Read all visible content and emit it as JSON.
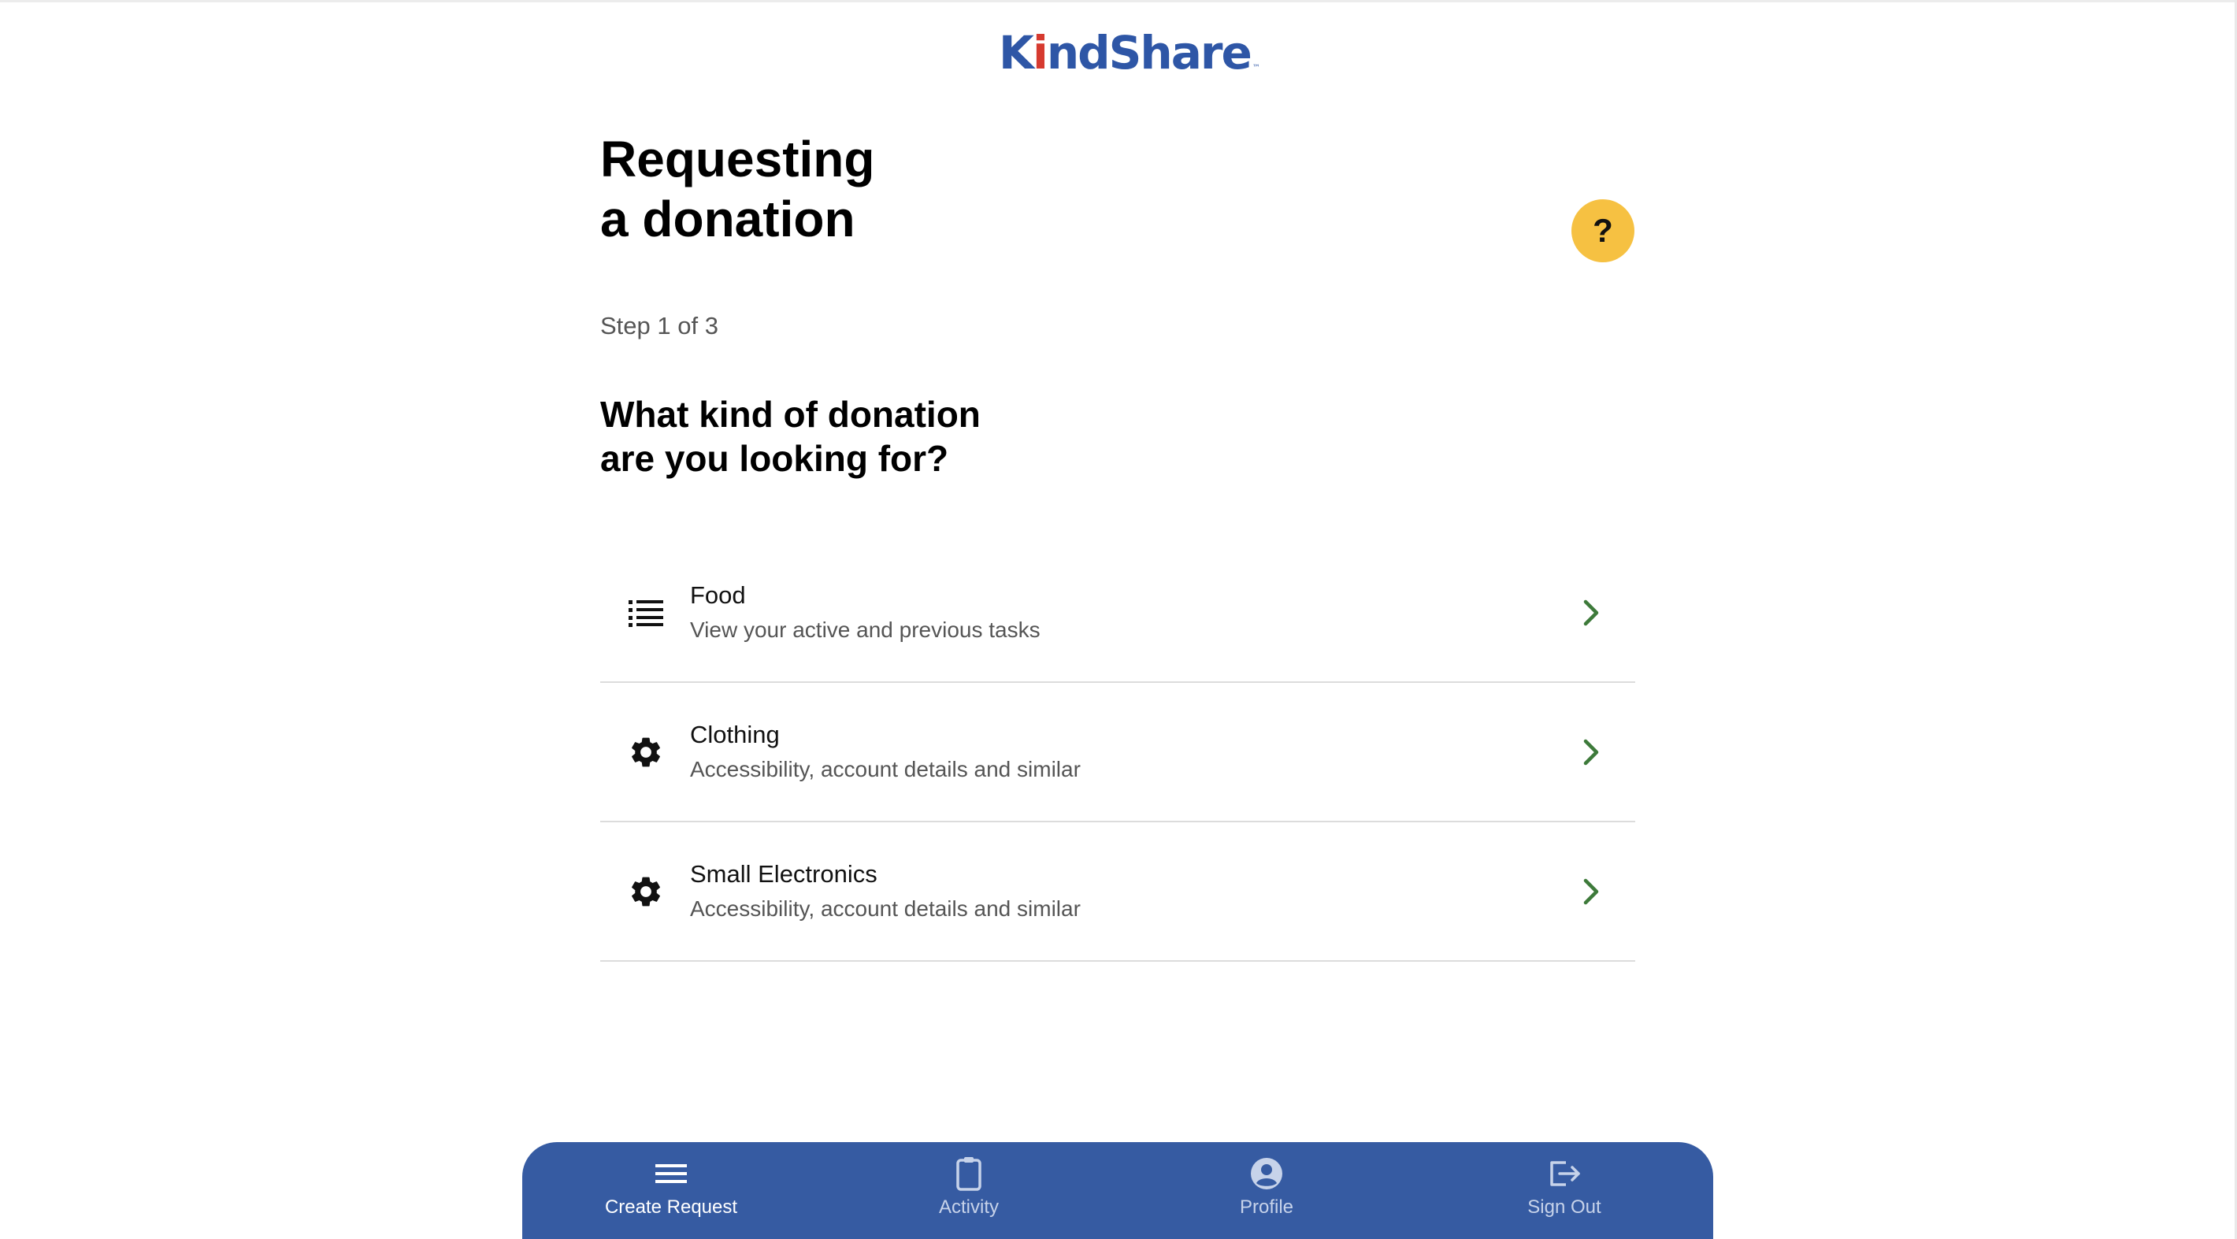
{
  "brand": {
    "logo_text_left": "K",
    "logo_text_i": "i",
    "logo_text_rest": "ndShare",
    "logo_tm": "™",
    "colors": {
      "primary": "#2e56a6",
      "accent_red": "#d63a2f",
      "help_yellow": "#f6c142",
      "chevron_green": "#3d7a3a",
      "nav_bg": "#365ba2"
    }
  },
  "header": {
    "title_line1": "Requesting",
    "title_line2": "a donation",
    "help_label": "?"
  },
  "wizard": {
    "step_label": "Step 1 of 3",
    "question_line1": "What kind of donation",
    "question_line2": "are you looking for?"
  },
  "options": [
    {
      "title": "Food",
      "subtitle": "View your active and previous tasks",
      "icon": "list-icon"
    },
    {
      "title": "Clothing",
      "subtitle": "Accessibility, account details and similar",
      "icon": "gear-icon"
    },
    {
      "title": "Small Electronics",
      "subtitle": "Accessibility, account details and similar",
      "icon": "gear-icon"
    }
  ],
  "nav": {
    "items": [
      {
        "label": "Create Request",
        "icon": "menu-icon",
        "active": true
      },
      {
        "label": "Activity",
        "icon": "clipboard-icon",
        "active": false
      },
      {
        "label": "Profile",
        "icon": "profile-icon",
        "active": false
      },
      {
        "label": "Sign Out",
        "icon": "sign-out-icon",
        "active": false
      }
    ]
  }
}
